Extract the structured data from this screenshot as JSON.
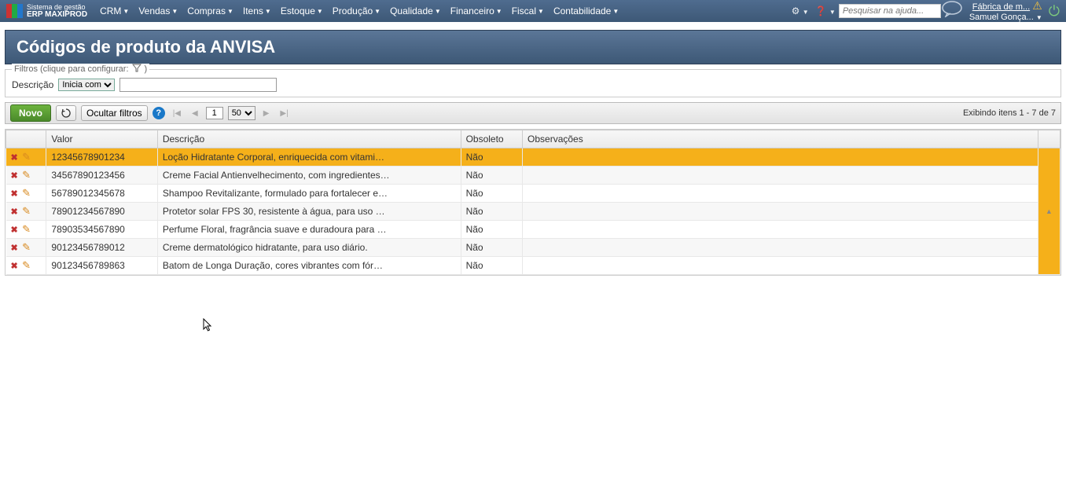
{
  "top": {
    "system_label": "Sistema de gestão",
    "system_name": "ERP MAXIPROD",
    "menus": [
      "CRM",
      "Vendas",
      "Compras",
      "Itens",
      "Estoque",
      "Produção",
      "Qualidade",
      "Financeiro",
      "Fiscal",
      "Contabilidade"
    ],
    "search_placeholder": "Pesquisar na ajuda...",
    "company": "Fábrica de m...",
    "user": "Samuel Gonça..."
  },
  "page": {
    "title": "Códigos de produto da ANVISA"
  },
  "filters": {
    "legend": "Filtros (clique para configurar:",
    "field_label": "Descrição",
    "operator_options": [
      "Inicia com"
    ],
    "operator_selected": "Inicia com",
    "value": ""
  },
  "toolbar": {
    "novo_label": "Novo",
    "ocultar_label": "Ocultar filtros",
    "page_current": "1",
    "page_size_options": [
      "50"
    ],
    "page_size_selected": "50",
    "item_count": "Exibindo itens 1 - 7 de 7"
  },
  "grid": {
    "headers": {
      "valor": "Valor",
      "descricao": "Descrição",
      "obsoleto": "Obsoleto",
      "observacoes": "Observações"
    },
    "rows": [
      {
        "valor": "12345678901234",
        "descricao": "Loção Hidratante Corporal, enriquecida com vitami…",
        "obsoleto": "Não",
        "obs": "",
        "selected": true
      },
      {
        "valor": "34567890123456",
        "descricao": "Creme Facial Antienvelhecimento, com ingredientes…",
        "obsoleto": "Não",
        "obs": ""
      },
      {
        "valor": "56789012345678",
        "descricao": "Shampoo Revitalizante, formulado para fortalecer e…",
        "obsoleto": "Não",
        "obs": ""
      },
      {
        "valor": "78901234567890",
        "descricao": "Protetor solar FPS 30, resistente à água, para uso …",
        "obsoleto": "Não",
        "obs": ""
      },
      {
        "valor": "78903534567890",
        "descricao": "Perfume Floral, fragrância suave e duradoura para …",
        "obsoleto": "Não",
        "obs": ""
      },
      {
        "valor": "90123456789012",
        "descricao": "Creme dermatológico hidratante, para uso diário.",
        "obsoleto": "Não",
        "obs": ""
      },
      {
        "valor": "90123456789863",
        "descricao": "Batom de Longa Duração, cores vibrantes com fór…",
        "obsoleto": "Não",
        "obs": ""
      }
    ]
  }
}
